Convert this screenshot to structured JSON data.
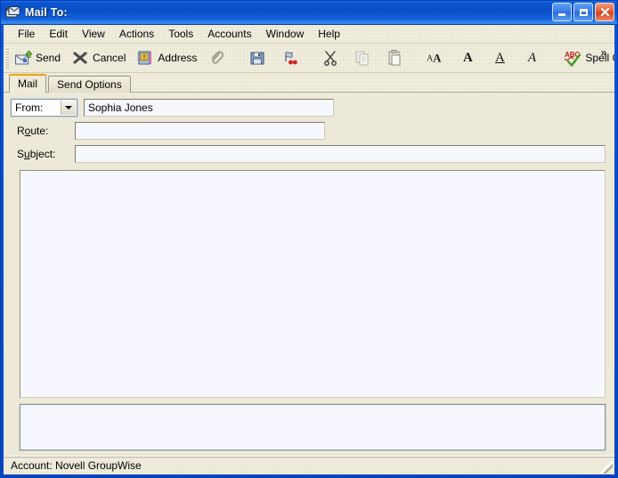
{
  "window": {
    "title": "Mail To:",
    "icon": "mail-compose-icon",
    "controls": {
      "minimize": "Minimize",
      "maximize": "Maximize",
      "close": "Close"
    }
  },
  "menu": {
    "items": [
      {
        "label": "File",
        "name": "menu-file"
      },
      {
        "label": "Edit",
        "name": "menu-edit"
      },
      {
        "label": "View",
        "name": "menu-view"
      },
      {
        "label": "Actions",
        "name": "menu-actions"
      },
      {
        "label": "Tools",
        "name": "menu-tools"
      },
      {
        "label": "Accounts",
        "name": "menu-accounts"
      },
      {
        "label": "Window",
        "name": "menu-window"
      },
      {
        "label": "Help",
        "name": "menu-help"
      }
    ]
  },
  "toolbar": {
    "send_label": "Send",
    "cancel_label": "Cancel",
    "address_label": "Address",
    "attach_label": "",
    "save_label": "",
    "priority_label": "",
    "cut_label": "",
    "copy_label": "",
    "paste_label": "",
    "font_label": "",
    "bold_label": "",
    "underline_label": "",
    "italic_label": "",
    "spell_check_label": "Spell Check",
    "overflow_label": "»",
    "icons": {
      "send": "send-mail-icon",
      "cancel": "cancel-x-icon",
      "address": "address-book-icon",
      "attach": "paperclip-icon",
      "save": "save-floppy-icon",
      "priority": "priority-flag-icon",
      "cut": "scissors-icon",
      "copy": "copy-icon",
      "paste": "paste-clipboard-icon",
      "font": "font-size-icon",
      "bold": "bold-icon",
      "underline": "underline-icon",
      "italic": "italic-icon",
      "spell_check": "spell-check-abc-icon",
      "overflow": "chevron-double-right-icon"
    },
    "glyphs": {
      "bold": "A",
      "underline": "A",
      "italic": "A",
      "font": "AA",
      "spell_abc": "ABC"
    }
  },
  "tabs": [
    {
      "label": "Mail",
      "name": "tab-mail",
      "active": true
    },
    {
      "label": "Send Options",
      "name": "tab-send-options",
      "active": false
    }
  ],
  "form": {
    "from": {
      "select_label": "From:",
      "value": "Sophia Jones",
      "placeholder": ""
    },
    "route": {
      "label_pre": "R",
      "label_accel": "o",
      "label_post": "ute:",
      "value": "",
      "placeholder": ""
    },
    "subject": {
      "label_pre": "S",
      "label_accel": "u",
      "label_post": "bject:",
      "value": "",
      "placeholder": ""
    }
  },
  "message_body": {
    "value": "",
    "placeholder": ""
  },
  "attachment_pane": {
    "value": "",
    "placeholder": ""
  },
  "statusbar": {
    "text": "Account: Novell GroupWise"
  },
  "colors": {
    "title_bar_blue": "#0A4CC6",
    "window_border_blue": "#0246C8",
    "client_beige": "#ECE9D8",
    "field_white": "#F7F7FF",
    "active_tab_accent": "#F0A30A",
    "close_button_red": "#CF4724",
    "send_arrow_green": "#4E9A27",
    "spell_check_red": "#C4201A"
  }
}
